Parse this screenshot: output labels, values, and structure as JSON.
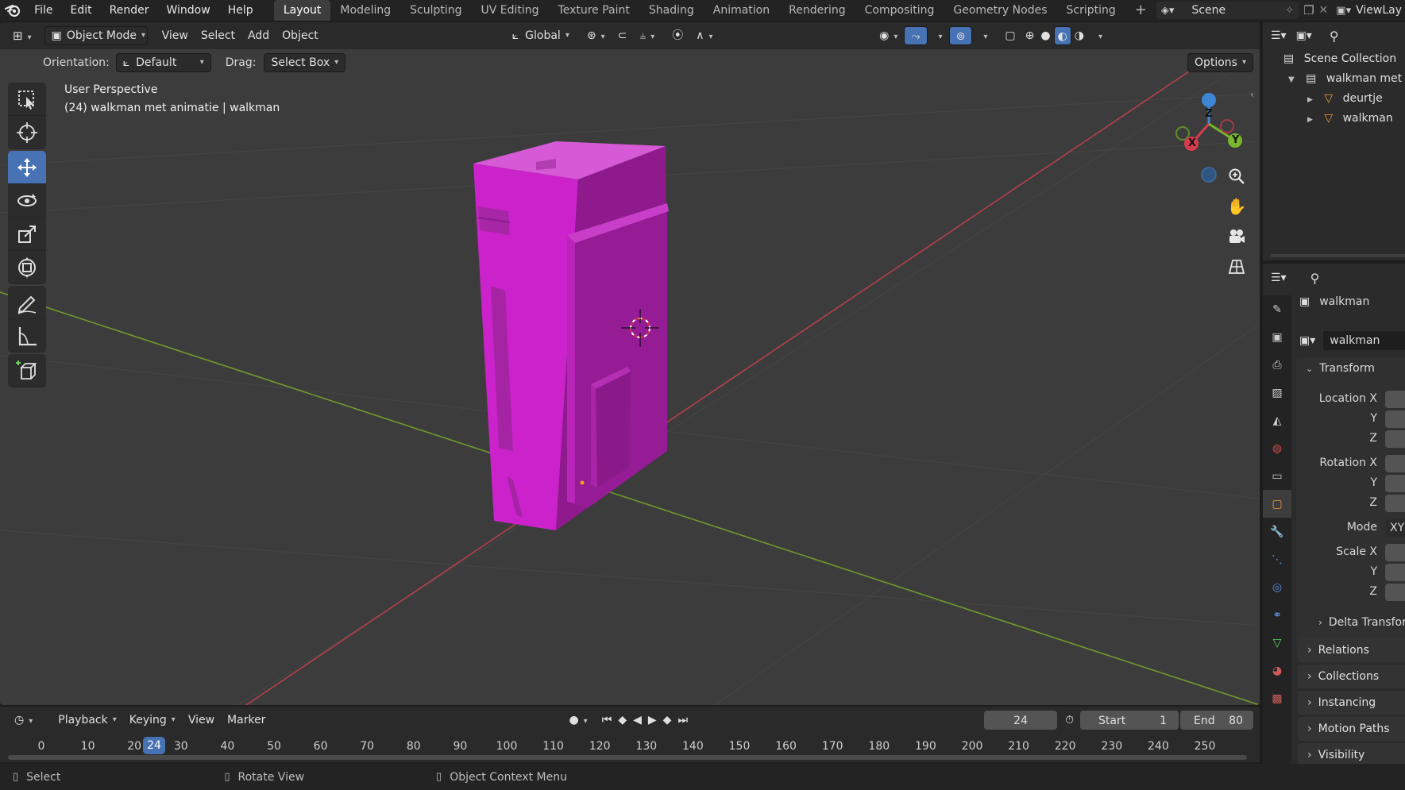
{
  "topbar": {
    "menus": [
      "File",
      "Edit",
      "Render",
      "Window",
      "Help"
    ],
    "workspaces": [
      "Layout",
      "Modeling",
      "Sculpting",
      "UV Editing",
      "Texture Paint",
      "Shading",
      "Animation",
      "Rendering",
      "Compositing",
      "Geometry Nodes",
      "Scripting"
    ],
    "active_workspace": "Layout",
    "add_tab": "+",
    "scene": "Scene",
    "view_layer": "ViewLay"
  },
  "viewport_header": {
    "mode": "Object Mode",
    "menus": [
      "View",
      "Select",
      "Add",
      "Object"
    ],
    "transform_orientation": "Global",
    "orientation_label": "Orientation:",
    "orientation_value": "Default",
    "drag_label": "Drag:",
    "drag_value": "Select Box",
    "options": "Options"
  },
  "viewport": {
    "view_name": "User Perspective",
    "object_info": "(24) walkman met animatie | walkman",
    "object_color": "#c81ec8",
    "gizmo": {
      "x": "X",
      "y": "Y",
      "z": "Z"
    }
  },
  "tools": [
    "select-box",
    "cursor",
    "move",
    "rotate",
    "scale",
    "transform",
    "annotate",
    "measure",
    "add-cube"
  ],
  "timeline": {
    "menus": [
      "Playback",
      "Keying",
      "View",
      "Marker"
    ],
    "current_frame": "24",
    "start_label": "Start",
    "start": "1",
    "end_label": "End",
    "end": "80",
    "ticks": [
      "0",
      "10",
      "20",
      "30",
      "40",
      "50",
      "60",
      "70",
      "80",
      "90",
      "100",
      "110",
      "120",
      "130",
      "140",
      "150",
      "160",
      "170",
      "180",
      "190",
      "200",
      "210",
      "220",
      "230",
      "240",
      "250"
    ]
  },
  "statusbar": {
    "items": [
      "Select",
      "Rotate View",
      "Object Context Menu"
    ]
  },
  "outliner": {
    "root": "Scene Collection",
    "collection": "walkman met a",
    "children": [
      "deurtje",
      "walkman"
    ]
  },
  "properties": {
    "object_name": "walkman",
    "data_name": "walkman",
    "transform_title": "Transform",
    "location_label": "Location X",
    "rotation_label": "Rotation X",
    "mode_label": "Mode",
    "mode_value": "XY",
    "scale_label": "Scale X",
    "y": "Y",
    "z": "Z",
    "panels": [
      "Delta Transfor",
      "Relations",
      "Collections",
      "Instancing",
      "Motion Paths",
      "Visibility"
    ]
  }
}
